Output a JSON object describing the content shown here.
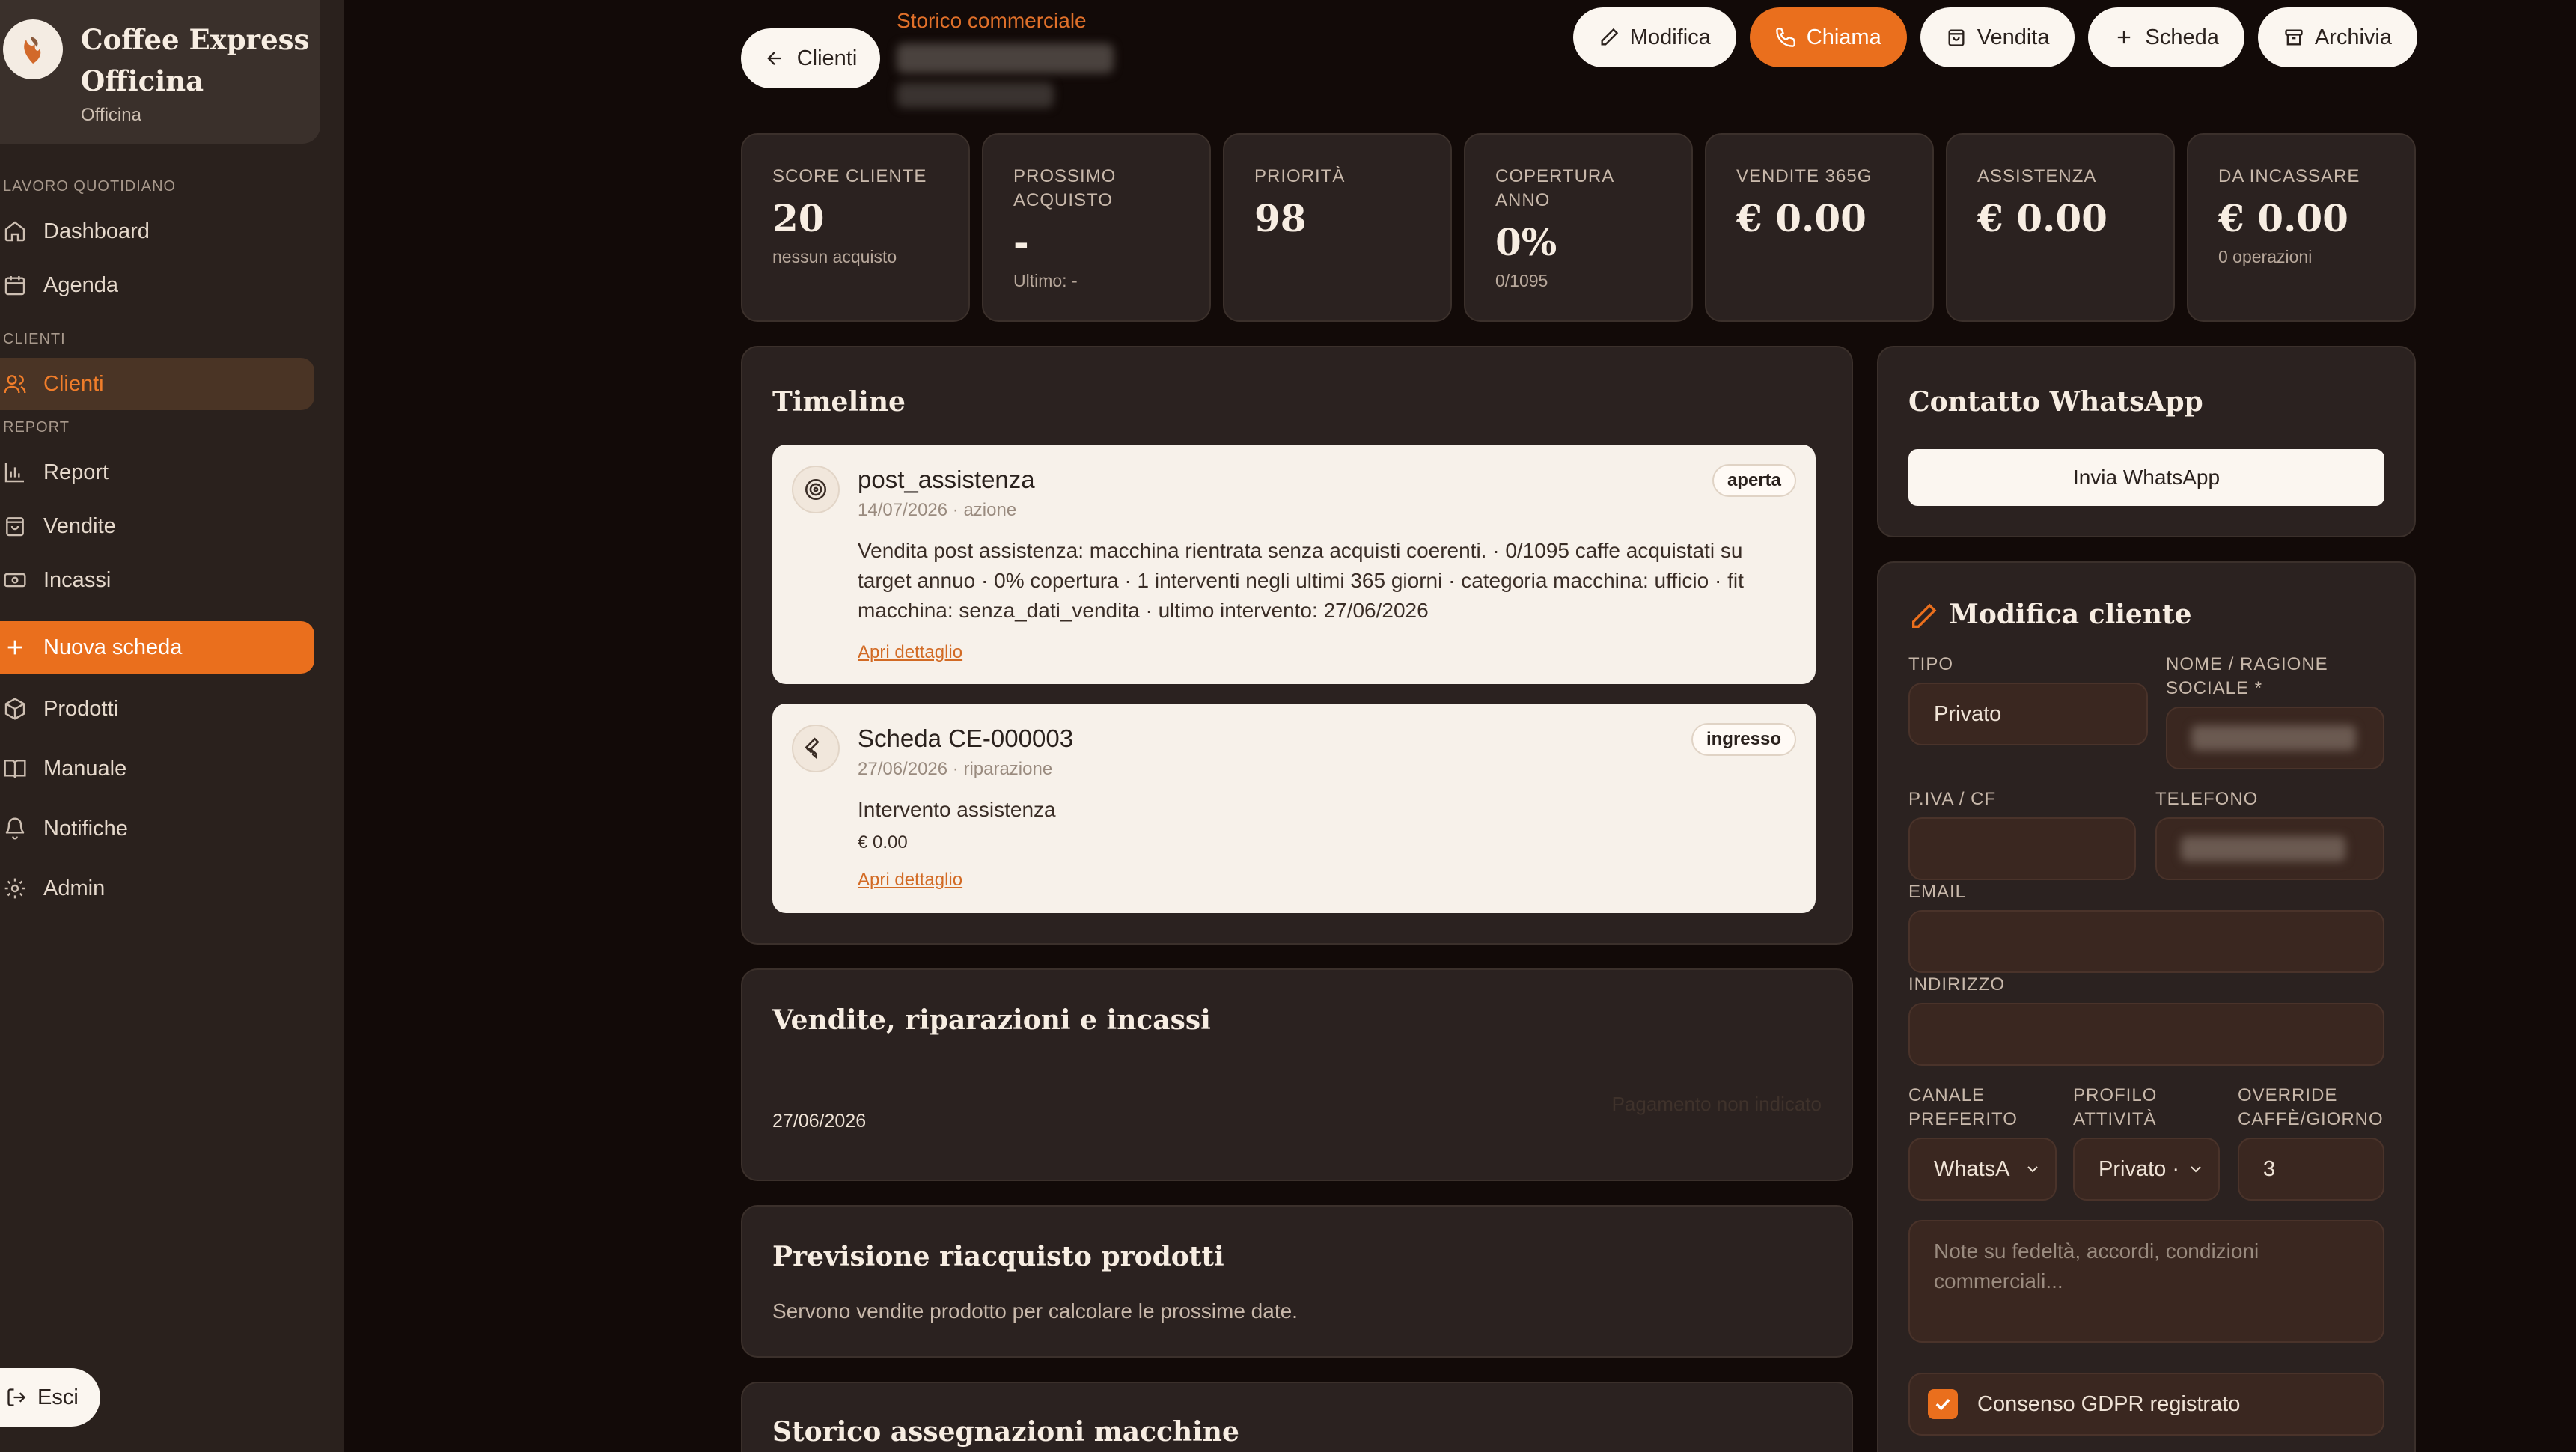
{
  "brand": {
    "name": "Coffee Express Officina",
    "name_line1": "Coffee Express",
    "name_line2": "Officina",
    "sub": "Officina"
  },
  "nav": {
    "section_daily": "LAVORO QUOTIDIANO",
    "dashboard": "Dashboard",
    "agenda": "Agenda",
    "section_clients": "CLIENTI",
    "clients": "Clienti",
    "section_report": "REPORT",
    "report": "Report",
    "sales": "Vendite",
    "payments": "Incassi",
    "new_card": "Nuova scheda",
    "products": "Prodotti",
    "manual": "Manuale",
    "notifications": "Notifiche",
    "admin": "Admin",
    "logout": "Esci"
  },
  "header": {
    "back_label": "Clienti",
    "eyebrow": "Storico commerciale",
    "actions": {
      "edit": "Modifica",
      "call": "Chiama",
      "sale": "Vendita",
      "card": "Scheda",
      "archive": "Archivia"
    }
  },
  "kpis": [
    {
      "label": "SCORE CLIENTE",
      "value": "20",
      "sub": "nessun acquisto"
    },
    {
      "label": "PROSSIMO ACQUISTO",
      "value": "-",
      "sub": "Ultimo: -"
    },
    {
      "label": "PRIORITÀ",
      "value": "98",
      "sub": ""
    },
    {
      "label": "COPERTURA ANNO",
      "value": "0%",
      "sub": "0/1095"
    },
    {
      "label": "VENDITE 365G",
      "value": "€ 0.00",
      "sub": ""
    },
    {
      "label": "ASSISTENZA",
      "value": "€ 0.00",
      "sub": ""
    },
    {
      "label": "DA INCASSARE",
      "value": "€ 0.00",
      "sub": "0 operazioni"
    }
  ],
  "timeline": {
    "title": "Timeline",
    "items": [
      {
        "icon": "target-icon",
        "title": "post_assistenza",
        "meta": "14/07/2026 · azione",
        "badge": "aperta",
        "body": "Vendita post assistenza: macchina rientrata senza acquisti coerenti. · 0/1095 caffe acquistati su target annuo · 0% copertura · 1 interventi negli ultimi 365 giorni · categoria macchina: ufficio · fit macchina: senza_dati_vendita · ultimo intervento: 27/06/2026",
        "link": "Apri dettaglio"
      },
      {
        "icon": "wrench-icon",
        "title": "Scheda CE-000003",
        "meta": "27/06/2026 · riparazione",
        "badge": "ingresso",
        "body": "Intervento assistenza",
        "amount": "€ 0.00",
        "link": "Apri dettaglio"
      }
    ]
  },
  "sales_panel": {
    "title": "Vendite, riparazioni e incassi",
    "row_date": "27/06/2026",
    "row_status": "Pagamento non indicato"
  },
  "forecast_panel": {
    "title": "Previsione riacquisto prodotti",
    "text": "Servono vendite prodotto per calcolare le prossime date."
  },
  "machines_panel": {
    "title": "Storico assegnazioni macchine"
  },
  "whatsapp": {
    "title": "Contatto WhatsApp",
    "button": "Invia WhatsApp"
  },
  "edit_form": {
    "title": "Modifica cliente",
    "type_label": "TIPO",
    "type_value": "Privato",
    "name_label": "NOME / RAGIONE SOCIALE *",
    "vat_label": "P.IVA / CF",
    "phone_label": "TELEFONO",
    "email_label": "EMAIL",
    "address_label": "INDIRIZZO",
    "channel_label": "CANALE PREFERITO",
    "channel_value": "WhatsA",
    "profile_label": "PROFILO ATTIVITÀ",
    "profile_value": "Privato ·",
    "override_label": "OVERRIDE CAFFÈ/GIORNO",
    "override_value": "3",
    "notes_placeholder": "Note su fedeltà, accordi, condizioni commerciali...",
    "gdpr_label": "Consenso GDPR registrato",
    "gdpr_checked": true
  },
  "colors": {
    "accent": "#ea6f1d",
    "background": "#120a08",
    "sidebar": "#2a211d",
    "card": "#2b2220"
  }
}
